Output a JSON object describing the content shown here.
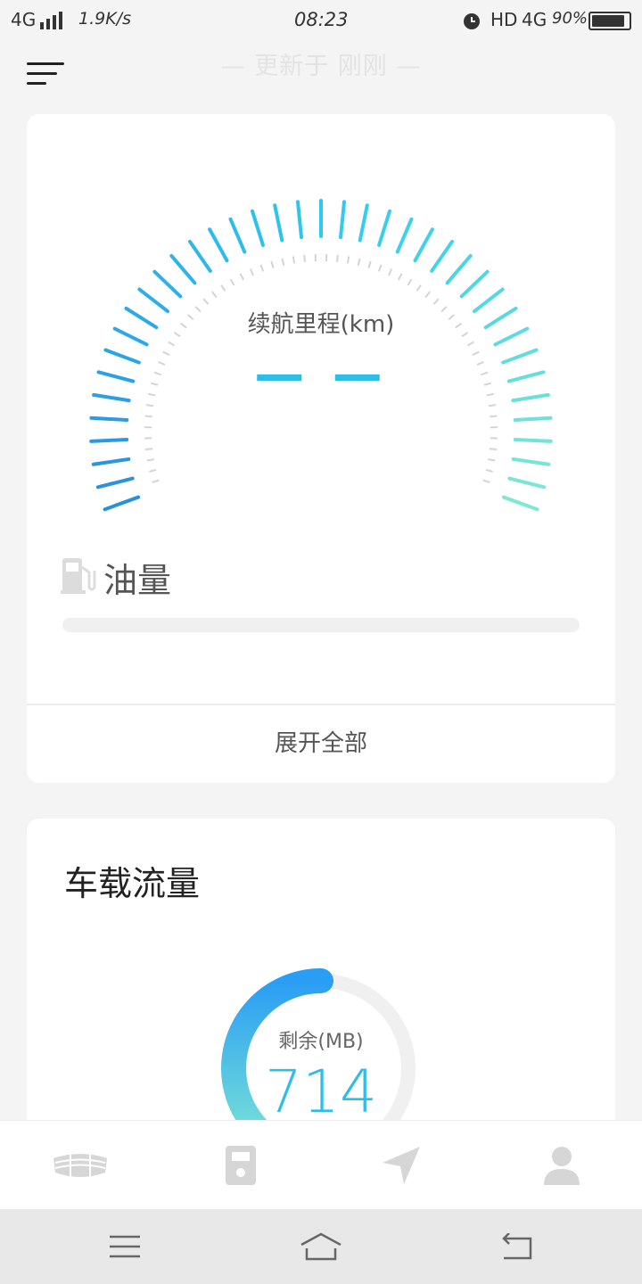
{
  "status_bar": {
    "network": "4G",
    "speed": "1.9K/s",
    "time": "08:23",
    "hd": "HD",
    "network2": "4G",
    "battery_text": "90%",
    "battery_level": 0.9,
    "icons": [
      "signal-icon",
      "alarm-icon",
      "battery-icon"
    ]
  },
  "header": {
    "update_text": "— 更新于 刚刚 —",
    "menu_icon": "menu-icon"
  },
  "range_card": {
    "label": "续航里程(km)",
    "value": "— —",
    "fuel_title": "油量",
    "fuel_icon": "fuel-pump-icon",
    "fuel_level": 0,
    "expand_label": "展开全部",
    "colors": {
      "gauge_start": "#2a8fe0",
      "gauge_mid": "#2ec9f0",
      "gauge_end": "#7ee8d4",
      "inner_ticks": "#d4d4d4"
    }
  },
  "data_card": {
    "title": "车载流量",
    "remaining_label": "剩余(MB)",
    "remaining_value": "714",
    "remaining_fraction": 0.6,
    "colors": {
      "ring_start": "#2a9df4",
      "ring_end": "#7ee8d4",
      "ring_track": "#f0f0f0"
    }
  },
  "tabs": [
    {
      "icon": "car-grille-icon"
    },
    {
      "icon": "fuel-station-icon"
    },
    {
      "icon": "navigation-arrow-icon"
    },
    {
      "icon": "profile-icon"
    }
  ],
  "system_nav": [
    {
      "icon": "menu-lines-icon"
    },
    {
      "icon": "home-icon"
    },
    {
      "icon": "back-icon"
    }
  ],
  "colors": {
    "accent": "#2cbde8",
    "inactive_icon": "#d6d6d6",
    "background": "#f4f4f5"
  }
}
